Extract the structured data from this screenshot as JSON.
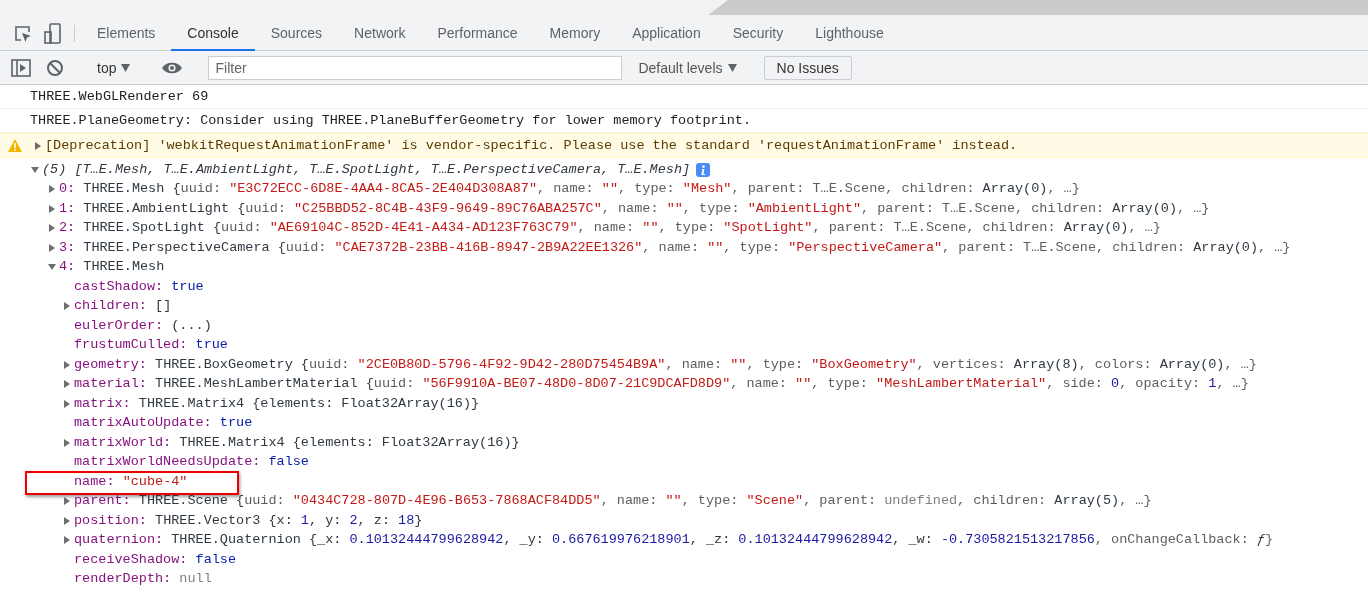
{
  "tabs": [
    {
      "label": "Elements",
      "selected": false
    },
    {
      "label": "Console",
      "selected": true
    },
    {
      "label": "Sources",
      "selected": false
    },
    {
      "label": "Network",
      "selected": false
    },
    {
      "label": "Performance",
      "selected": false
    },
    {
      "label": "Memory",
      "selected": false
    },
    {
      "label": "Application",
      "selected": false
    },
    {
      "label": "Security",
      "selected": false
    },
    {
      "label": "Lighthouse",
      "selected": false
    }
  ],
  "toolbar": {
    "context": "top",
    "filter": {
      "placeholder": "Filter"
    },
    "levels": "Default levels",
    "issues": "No Issues"
  },
  "messages": [
    {
      "kind": "log",
      "text": "THREE.WebGLRenderer 69"
    },
    {
      "kind": "log",
      "text": "THREE.PlaneGeometry: Consider using THREE.PlaneBufferGeometry for lower memory footprint."
    },
    {
      "kind": "warning",
      "expanded": false,
      "text": "[Deprecation] 'webkitRequestAnimationFrame' is vendor-specific. Please use the standard 'requestAnimationFrame' instead."
    },
    {
      "kind": "group",
      "expanded": true,
      "count": "(5)",
      "summary": "[T…E.Mesh, T…E.AmbientLight, T…E.SpotLight, T…E.PerspectiveCamera, T…E.Mesh]",
      "children": [
        {
          "key": "0:",
          "expanded": false,
          "value": [
            {
              "kind": "plain",
              "text": "THREE.Mesh {"
            },
            {
              "kind": "dim",
              "text": "uuid: "
            },
            {
              "kind": "string",
              "text": "\"E3C72ECC-6D8E-4AA4-8CA5-2E404D308A87\""
            },
            {
              "kind": "dim",
              "text": ", name: "
            },
            {
              "kind": "string",
              "text": "\"\""
            },
            {
              "kind": "dim",
              "text": ", type: "
            },
            {
              "kind": "string",
              "text": "\"Mesh\""
            },
            {
              "kind": "dim",
              "text": ", parent: T…E.Scene, children: "
            },
            {
              "kind": "plain",
              "text": "Array(0)"
            },
            {
              "kind": "dim",
              "text": ", …}"
            }
          ]
        },
        {
          "key": "1:",
          "expanded": false,
          "value": [
            {
              "kind": "plain",
              "text": "THREE.AmbientLight {"
            },
            {
              "kind": "dim",
              "text": "uuid: "
            },
            {
              "kind": "string",
              "text": "\"C25BBD52-8C4B-43F9-9649-89C76ABA257C\""
            },
            {
              "kind": "dim",
              "text": ", name: "
            },
            {
              "kind": "string",
              "text": "\"\""
            },
            {
              "kind": "dim",
              "text": ", type: "
            },
            {
              "kind": "string",
              "text": "\"AmbientLight\""
            },
            {
              "kind": "dim",
              "text": ", parent: T…E.Scene, children: "
            },
            {
              "kind": "plain",
              "text": "Array(0)"
            },
            {
              "kind": "dim",
              "text": ", …}"
            }
          ]
        },
        {
          "key": "2:",
          "expanded": false,
          "value": [
            {
              "kind": "plain",
              "text": "THREE.SpotLight {"
            },
            {
              "kind": "dim",
              "text": "uuid: "
            },
            {
              "kind": "string",
              "text": "\"AE69104C-852D-4E41-A434-AD123F763C79\""
            },
            {
              "kind": "dim",
              "text": ", name: "
            },
            {
              "kind": "string",
              "text": "\"\""
            },
            {
              "kind": "dim",
              "text": ", type: "
            },
            {
              "kind": "string",
              "text": "\"SpotLight\""
            },
            {
              "kind": "dim",
              "text": ", parent: T…E.Scene, children: "
            },
            {
              "kind": "plain",
              "text": "Array(0)"
            },
            {
              "kind": "dim",
              "text": ", …}"
            }
          ]
        },
        {
          "key": "3:",
          "expanded": false,
          "value": [
            {
              "kind": "plain",
              "text": "THREE.PerspectiveCamera {"
            },
            {
              "kind": "dim",
              "text": "uuid: "
            },
            {
              "kind": "string",
              "text": "\"CAE7372B-23BB-416B-8947-2B9A22EE1326\""
            },
            {
              "kind": "dim",
              "text": ", name: "
            },
            {
              "kind": "string",
              "text": "\"\""
            },
            {
              "kind": "dim",
              "text": ", type: "
            },
            {
              "kind": "string",
              "text": "\"PerspectiveCamera\""
            },
            {
              "kind": "dim",
              "text": ", parent: T…E.Scene, children: "
            },
            {
              "kind": "plain",
              "text": "Array(0)"
            },
            {
              "kind": "dim",
              "text": ", …}"
            }
          ]
        },
        {
          "key": "4:",
          "expanded": true,
          "value": [
            {
              "kind": "plain",
              "text": "THREE.Mesh"
            }
          ],
          "children": [
            {
              "key": "castShadow:",
              "value": [
                {
                  "kind": "keyword",
                  "text": "true"
                }
              ]
            },
            {
              "key": "children:",
              "expanded": false,
              "value": [
                {
                  "kind": "plain",
                  "text": "[]"
                }
              ]
            },
            {
              "key": "eulerOrder:",
              "value": [
                {
                  "kind": "plain",
                  "text": "(...)"
                }
              ]
            },
            {
              "key": "frustumCulled:",
              "value": [
                {
                  "kind": "keyword",
                  "text": "true"
                }
              ]
            },
            {
              "key": "geometry:",
              "expanded": false,
              "value": [
                {
                  "kind": "plain",
                  "text": "THREE.BoxGeometry {"
                },
                {
                  "kind": "dim",
                  "text": "uuid: "
                },
                {
                  "kind": "string",
                  "text": "\"2CE0B80D-5796-4F92-9D42-280D75454B9A\""
                },
                {
                  "kind": "dim",
                  "text": ", name: "
                },
                {
                  "kind": "string",
                  "text": "\"\""
                },
                {
                  "kind": "dim",
                  "text": ", type: "
                },
                {
                  "kind": "string",
                  "text": "\"BoxGeometry\""
                },
                {
                  "kind": "dim",
                  "text": ", vertices: "
                },
                {
                  "kind": "plain",
                  "text": "Array(8)"
                },
                {
                  "kind": "dim",
                  "text": ", colors: "
                },
                {
                  "kind": "plain",
                  "text": "Array(0)"
                },
                {
                  "kind": "dim",
                  "text": ", …}"
                }
              ]
            },
            {
              "key": "material:",
              "expanded": false,
              "value": [
                {
                  "kind": "plain",
                  "text": "THREE.MeshLambertMaterial {"
                },
                {
                  "kind": "dim",
                  "text": "uuid: "
                },
                {
                  "kind": "string",
                  "text": "\"56F9910A-BE07-48D0-8D07-21C9DCAFD8D9\""
                },
                {
                  "kind": "dim",
                  "text": ", name: "
                },
                {
                  "kind": "string",
                  "text": "\"\""
                },
                {
                  "kind": "dim",
                  "text": ", type: "
                },
                {
                  "kind": "string",
                  "text": "\"MeshLambertMaterial\""
                },
                {
                  "kind": "dim",
                  "text": ", side: "
                },
                {
                  "kind": "number",
                  "text": "0"
                },
                {
                  "kind": "dim",
                  "text": ", opacity: "
                },
                {
                  "kind": "number",
                  "text": "1"
                },
                {
                  "kind": "dim",
                  "text": ", …}"
                }
              ]
            },
            {
              "key": "matrix:",
              "expanded": false,
              "value": [
                {
                  "kind": "plain",
                  "text": "THREE.Matrix4 {elements: Float32Array(16)}"
                }
              ]
            },
            {
              "key": "matrixAutoUpdate:",
              "value": [
                {
                  "kind": "keyword",
                  "text": "true"
                }
              ]
            },
            {
              "key": "matrixWorld:",
              "expanded": false,
              "value": [
                {
                  "kind": "plain",
                  "text": "THREE.Matrix4 {elements: Float32Array(16)}"
                }
              ]
            },
            {
              "key": "matrixWorldNeedsUpdate:",
              "value": [
                {
                  "kind": "keyword",
                  "text": "false"
                }
              ]
            },
            {
              "key": "name:",
              "highlighted": true,
              "value": [
                {
                  "kind": "string",
                  "text": "\"cube-4\""
                }
              ]
            },
            {
              "key": "parent:",
              "expanded": false,
              "value": [
                {
                  "kind": "plain",
                  "text": "THREE.Scene {"
                },
                {
                  "kind": "dim",
                  "text": "uuid: "
                },
                {
                  "kind": "string",
                  "text": "\"0434C728-807D-4E96-B653-7868ACF84DD5\""
                },
                {
                  "kind": "dim",
                  "text": ", name: "
                },
                {
                  "kind": "string",
                  "text": "\"\""
                },
                {
                  "kind": "dim",
                  "text": ", type: "
                },
                {
                  "kind": "string",
                  "text": "\"Scene\""
                },
                {
                  "kind": "dim",
                  "text": ", parent: "
                },
                {
                  "kind": "faint",
                  "text": "undefined"
                },
                {
                  "kind": "dim",
                  "text": ", children: "
                },
                {
                  "kind": "plain",
                  "text": "Array(5)"
                },
                {
                  "kind": "dim",
                  "text": ", …}"
                }
              ]
            },
            {
              "key": "position:",
              "expanded": false,
              "value": [
                {
                  "kind": "plain",
                  "text": "THREE.Vector3 {x: "
                },
                {
                  "kind": "number",
                  "text": "1"
                },
                {
                  "kind": "plain",
                  "text": ", y: "
                },
                {
                  "kind": "number",
                  "text": "2"
                },
                {
                  "kind": "plain",
                  "text": ", z: "
                },
                {
                  "kind": "number",
                  "text": "18"
                },
                {
                  "kind": "plain",
                  "text": "}"
                }
              ]
            },
            {
              "key": "quaternion:",
              "expanded": false,
              "value": [
                {
                  "kind": "plain",
                  "text": "THREE.Quaternion {_x: "
                },
                {
                  "kind": "number",
                  "text": "0.10132444799628942"
                },
                {
                  "kind": "plain",
                  "text": ", _y: "
                },
                {
                  "kind": "number",
                  "text": "0.667619976218901"
                },
                {
                  "kind": "plain",
                  "text": ", _z: "
                },
                {
                  "kind": "number",
                  "text": "0.10132444799628942"
                },
                {
                  "kind": "plain",
                  "text": ", _w: "
                },
                {
                  "kind": "number",
                  "text": "-0.7305821513217856"
                },
                {
                  "kind": "dim",
                  "text": ", onChangeCallback: "
                },
                {
                  "kind": "italic",
                  "text": "ƒ"
                },
                {
                  "kind": "dim",
                  "text": "}"
                }
              ]
            },
            {
              "key": "receiveShadow:",
              "value": [
                {
                  "kind": "keyword",
                  "text": "false"
                }
              ]
            },
            {
              "key": "renderDepth:",
              "value": [
                {
                  "kind": "faint",
                  "text": "null"
                }
              ]
            }
          ]
        }
      ]
    }
  ]
}
